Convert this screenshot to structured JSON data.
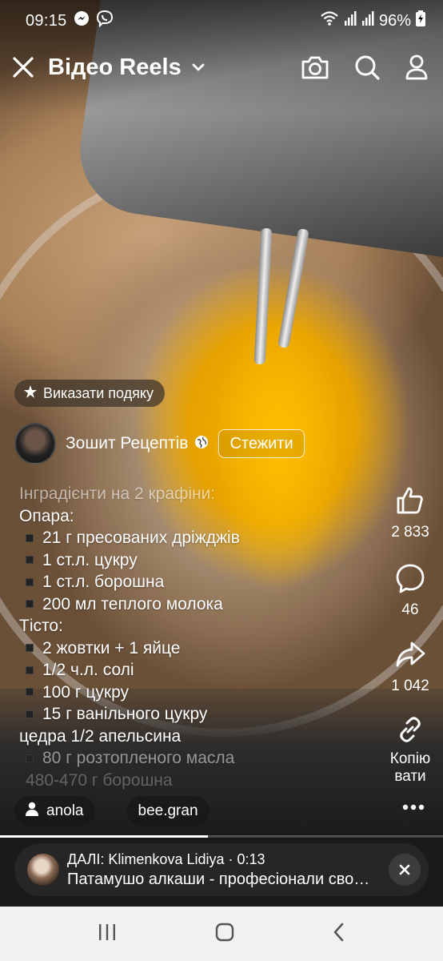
{
  "status_bar": {
    "time": "09:15",
    "battery": "96%",
    "icons": [
      "messenger-icon",
      "viber-icon",
      "wifi-icon",
      "signal-icon",
      "signal-icon",
      "battery-charging-icon"
    ]
  },
  "header": {
    "title": "Відео Reels",
    "icons": [
      "close-icon",
      "chevron-down-icon",
      "camera-icon",
      "search-icon",
      "profile-icon"
    ]
  },
  "thanks_button": {
    "label": "Виказати подяку",
    "icon": "gift-star-icon"
  },
  "author": {
    "name": "Зошит Рецептів",
    "follow_label": "Стежити",
    "icon": "globe-icon"
  },
  "caption": {
    "intro": "Інградієнти на 2 крафіни:",
    "section1": "Опара:",
    "items1": [
      "21 г пресованих дріжджів",
      "1 ст.л. цукру",
      "1 ст.л. борошна",
      "200 мл теплого молока"
    ],
    "section2": "Тісто:",
    "items2": [
      "2 жовтки + 1 яйце",
      "1/2 ч.л. солі",
      "100 г цукру",
      "15 г ванільного цукру",
      "цедра 1/2 апельсина",
      "80 г розтопленого масла",
      "480-470 г борошна"
    ]
  },
  "actions": {
    "like_count": "2 833",
    "comment_count": "46",
    "share_count": "1 042",
    "copy_label_line1": "Копію",
    "copy_label_line2": "вати"
  },
  "tags": [
    "anola",
    "bee.gran"
  ],
  "progress_fraction": 0.47,
  "next_up": {
    "prefix": "ДАЛІ: Klimenkova Lidiya · 0:13",
    "title": "Патамушо алкаши - професіонали своєї справи"
  },
  "colors": {
    "accent_yolk": "#f0b000",
    "nav_bg": "#f2f2f2",
    "next_bg": "#1a1a1a"
  }
}
